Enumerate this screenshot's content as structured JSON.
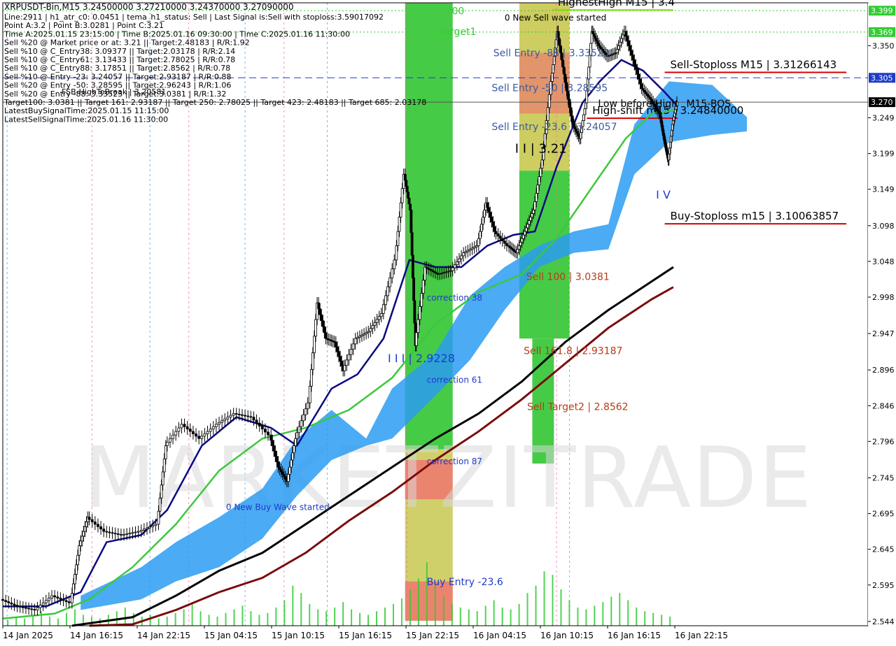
{
  "chart_data": {
    "type": "line",
    "symbol_line": "XRPUSDT-Bin,M15  3.24500000 3.27210000 3.24370000 3.27090000",
    "info_lines": [
      "Line:2911  |  h1_atr_c0: 0.0451  |  tema_h1_status: Sell  |  Last Signal is:Sell with stoploss:3.59017092",
      "Point A:3.2  |  Point B:3.0281  |  Point C:3.21",
      "Time A:2025.01.15 23:15:00  |  Time B:2025.01.16 09:30:00  |  Time C:2025.01.16 11:30:00",
      "Sell %20 @ Market price or at: 3.21  ||  Target:2.48183  |  R/R:1.92",
      "Sell %10 @ C_Entry38: 3.09377  ||  Target:2.03178  |  R/R:2.14",
      "Sell %10 @ C_Entry61: 3.13433  ||  Target:2.78025  |  R/R:0.78",
      "Sell %10 @ C_Entry88: 3.17851  ||  Target:2.8562  |  R/R:0.78",
      "Sell %10 @ Entry -23: 3.24057  ||  Target:2.93187  |  R/R:0.88",
      "Sell %20 @ Entry -50: 3.28595  ||  Target:2.96243  |  R/R:1.06",
      "Sell %20 @ Entry -88: 3.33523  ||  Target:3.0381  |  R/R:1.32",
      "Target100: 3.0381  ||  Target 161: 2.93187  ||  Target 250: 2.78025  ||  Target 423: 2.48183  ||  Target 685: 2.03178",
      "LatestBuySignalTime:2025.01.15 11:15:00",
      "LatestSellSignalTime:2025.01.16 11:30:00"
    ],
    "fsb_label": "FSB-HighToBreak  |  3.20581",
    "x_tick_labels": [
      "14 Jan 2025",
      "14 Jan 16:15",
      "14 Jan 22:15",
      "15 Jan 04:15",
      "15 Jan 10:15",
      "15 Jan 16:15",
      "15 Jan 22:15",
      "16 Jan 04:15",
      "16 Jan 10:15",
      "16 Jan 16:15",
      "16 Jan 22:15"
    ],
    "y_ticks": [
      3.35,
      3.249,
      3.199,
      3.149,
      3.098,
      3.048,
      2.998,
      2.947,
      2.896,
      2.846,
      2.796,
      2.745,
      2.695,
      2.645,
      2.595,
      2.544
    ],
    "y_tick_labels": [
      "3.350",
      "3.249",
      "3.199",
      "3.149",
      "3.098",
      "3.048",
      "2.998",
      "2.947",
      "2.896",
      "2.846",
      "2.796",
      "2.745",
      "2.695",
      "2.645",
      "2.595",
      "2.544"
    ],
    "ylim": [
      2.538,
      3.41
    ],
    "price_tags": [
      {
        "value": 3.399,
        "label": "3.399",
        "color": "#32cd32"
      },
      {
        "value": 3.369,
        "label": "3.369",
        "color": "#32cd32"
      },
      {
        "value": 3.305,
        "label": "3.305",
        "color": "#1e3cc8"
      },
      {
        "value": 3.2709,
        "label": "3.270",
        "color": "#000000"
      }
    ],
    "h_lines": [
      {
        "value": 3.399,
        "color": "#32cd32",
        "dash": "2,3"
      },
      {
        "value": 3.369,
        "color": "#32cd32",
        "dash": "2,3"
      },
      {
        "value": 3.305,
        "color": "#1e3cc8",
        "dash": "10,6"
      },
      {
        "value": 3.2709,
        "color": "#555555",
        "dash": ""
      }
    ],
    "levels": [
      {
        "label": "HighestHigh   M15 | 3.4",
        "value": 3.4,
        "color": "#000000",
        "line_color": "#7fe000",
        "from": 0.635,
        "to": 0.775
      },
      {
        "label": "Sell-Stoploss M15 | 3.31266143",
        "value": 3.31266143,
        "color": "#000000",
        "line_color": "#d40000",
        "from": 0.765,
        "to": 0.975
      },
      {
        "label": "High-shift m15 | 3.24840000",
        "value": 3.2484,
        "color": "#000000",
        "line_color": "#d40000",
        "from": 0.675,
        "to": 0.78
      },
      {
        "label": "Buy-Stoploss m15 | 3.10063857",
        "value": 3.10063857,
        "color": "#000000",
        "line_color": "#d40000",
        "from": 0.765,
        "to": 0.975
      }
    ],
    "annotations": [
      {
        "text": "0 New Sell wave started",
        "x": 0.58,
        "y": 3.385,
        "color": "#000000",
        "size": 12
      },
      {
        "text": "Sell Entry -88 | 3.33523",
        "x": 0.567,
        "y": 3.335,
        "color": "#3c5aa0",
        "size": 14
      },
      {
        "text": "Sell Entry -50 | 3.28595",
        "x": 0.565,
        "y": 3.286,
        "color": "#3c5aa0",
        "size": 14
      },
      {
        "text": "Sell Entry -23.6 | 3.24057",
        "x": 0.565,
        "y": 3.232,
        "color": "#3c5aa0",
        "size": 14
      },
      {
        "text": "Low before High",
        "x": 0.688,
        "y": 3.264,
        "color": "#000000",
        "size": 14
      },
      {
        "text": "M15-BOS",
        "x": 0.79,
        "y": 3.264,
        "color": "#000000",
        "size": 14
      },
      {
        "text": "I I | 3.21",
        "x": 0.592,
        "y": 3.2,
        "color": "#000000",
        "size": 18
      },
      {
        "text": "I V",
        "x": 0.755,
        "y": 3.136,
        "color": "#1e3cc8",
        "size": 16
      },
      {
        "text": "Sell 100 | 3.0381",
        "x": 0.605,
        "y": 3.022,
        "color": "#b43c14",
        "size": 14
      },
      {
        "text": "Sell 161.8 | 2.93187",
        "x": 0.602,
        "y": 2.918,
        "color": "#b43c14",
        "size": 14
      },
      {
        "text": "Sell Target2 | 2.8562",
        "x": 0.606,
        "y": 2.84,
        "color": "#b43c14",
        "size": 14
      },
      {
        "text": "I I I | 2.9228",
        "x": 0.445,
        "y": 2.907,
        "color": "#1e3cc8",
        "size": 16
      },
      {
        "text": "correction 38",
        "x": 0.49,
        "y": 2.993,
        "color": "#1e3cc8",
        "size": 12
      },
      {
        "text": "correction 61",
        "x": 0.49,
        "y": 2.878,
        "color": "#1e3cc8",
        "size": 12
      },
      {
        "text": "correction 87",
        "x": 0.49,
        "y": 2.764,
        "color": "#1e3cc8",
        "size": 12
      },
      {
        "text": "Buy Entry -23.6",
        "x": 0.49,
        "y": 2.595,
        "color": "#1e3cc8",
        "size": 14
      },
      {
        "text": "0 New Buy Wave started",
        "x": 0.258,
        "y": 2.7,
        "color": "#1e3cc8",
        "size": 12
      },
      {
        "text": "Target1",
        "x": 0.505,
        "y": 3.365,
        "color": "#32cd32",
        "size": 14
      },
      {
        "text": "00",
        "x": 0.519,
        "y": 3.394,
        "color": "#32cd32",
        "size": 14
      }
    ],
    "zones": [
      {
        "x0": 0.465,
        "x1": 0.52,
        "y0": 3.41,
        "y1": 2.785,
        "color": "#3cc83c",
        "opacity": 0.95
      },
      {
        "x0": 0.465,
        "x1": 0.52,
        "y0": 2.785,
        "y1": 2.545,
        "color": "#c8c850",
        "opacity": 0.85
      },
      {
        "x0": 0.465,
        "x1": 0.52,
        "y0": 2.77,
        "y1": 2.715,
        "color": "#f07070",
        "opacity": 0.8
      },
      {
        "x0": 0.465,
        "x1": 0.52,
        "y0": 2.6,
        "y1": 2.545,
        "color": "#f07070",
        "opacity": 0.8
      },
      {
        "x0": 0.597,
        "x1": 0.655,
        "y0": 3.41,
        "y1": 3.175,
        "color": "#c8c850",
        "opacity": 0.9
      },
      {
        "x0": 0.597,
        "x1": 0.655,
        "y0": 3.34,
        "y1": 3.255,
        "color": "#f07070",
        "opacity": 0.6
      },
      {
        "x0": 0.597,
        "x1": 0.655,
        "y0": 3.175,
        "y1": 2.94,
        "color": "#3cc83c",
        "opacity": 0.95
      },
      {
        "x0": 0.612,
        "x1": 0.637,
        "y0": 2.94,
        "y1": 2.765,
        "color": "#3cc83c",
        "opacity": 0.95
      }
    ],
    "watermark": "MARKETZITRADE",
    "price_series": [
      {
        "t": 0.0,
        "v": 2.575
      },
      {
        "t": 0.02,
        "v": 2.565
      },
      {
        "t": 0.04,
        "v": 2.56
      },
      {
        "t": 0.06,
        "v": 2.58
      },
      {
        "t": 0.08,
        "v": 2.57
      },
      {
        "t": 0.09,
        "v": 2.65
      },
      {
        "t": 0.1,
        "v": 2.69
      },
      {
        "t": 0.12,
        "v": 2.67
      },
      {
        "t": 0.14,
        "v": 2.665
      },
      {
        "t": 0.16,
        "v": 2.67
      },
      {
        "t": 0.18,
        "v": 2.68
      },
      {
        "t": 0.19,
        "v": 2.79
      },
      {
        "t": 0.21,
        "v": 2.82
      },
      {
        "t": 0.23,
        "v": 2.8
      },
      {
        "t": 0.25,
        "v": 2.82
      },
      {
        "t": 0.27,
        "v": 2.835
      },
      {
        "t": 0.29,
        "v": 2.83
      },
      {
        "t": 0.31,
        "v": 2.805
      },
      {
        "t": 0.32,
        "v": 2.76
      },
      {
        "t": 0.33,
        "v": 2.74
      },
      {
        "t": 0.34,
        "v": 2.8
      },
      {
        "t": 0.355,
        "v": 2.85
      },
      {
        "t": 0.365,
        "v": 2.99
      },
      {
        "t": 0.375,
        "v": 2.94
      },
      {
        "t": 0.385,
        "v": 2.935
      },
      {
        "t": 0.395,
        "v": 2.895
      },
      {
        "t": 0.41,
        "v": 2.94
      },
      {
        "t": 0.425,
        "v": 2.95
      },
      {
        "t": 0.44,
        "v": 2.975
      },
      {
        "t": 0.455,
        "v": 3.05
      },
      {
        "t": 0.465,
        "v": 3.17
      },
      {
        "t": 0.472,
        "v": 3.12
      },
      {
        "t": 0.478,
        "v": 2.93
      },
      {
        "t": 0.49,
        "v": 3.04
      },
      {
        "t": 0.505,
        "v": 3.03
      },
      {
        "t": 0.52,
        "v": 3.035
      },
      {
        "t": 0.535,
        "v": 3.06
      },
      {
        "t": 0.55,
        "v": 3.07
      },
      {
        "t": 0.56,
        "v": 3.13
      },
      {
        "t": 0.57,
        "v": 3.09
      },
      {
        "t": 0.585,
        "v": 3.07
      },
      {
        "t": 0.595,
        "v": 3.06
      },
      {
        "t": 0.605,
        "v": 3.09
      },
      {
        "t": 0.615,
        "v": 3.12
      },
      {
        "t": 0.625,
        "v": 3.19
      },
      {
        "t": 0.635,
        "v": 3.3
      },
      {
        "t": 0.642,
        "v": 3.37
      },
      {
        "t": 0.65,
        "v": 3.31
      },
      {
        "t": 0.66,
        "v": 3.24
      },
      {
        "t": 0.668,
        "v": 3.22
      },
      {
        "t": 0.675,
        "v": 3.27
      },
      {
        "t": 0.682,
        "v": 3.37
      },
      {
        "t": 0.69,
        "v": 3.35
      },
      {
        "t": 0.7,
        "v": 3.335
      },
      {
        "t": 0.71,
        "v": 3.34
      },
      {
        "t": 0.72,
        "v": 3.37
      },
      {
        "t": 0.73,
        "v": 3.33
      },
      {
        "t": 0.74,
        "v": 3.29
      },
      {
        "t": 0.75,
        "v": 3.275
      },
      {
        "t": 0.76,
        "v": 3.255
      },
      {
        "t": 0.765,
        "v": 3.22
      },
      {
        "t": 0.77,
        "v": 3.19
      },
      {
        "t": 0.775,
        "v": 3.24
      },
      {
        "t": 0.78,
        "v": 3.271
      }
    ],
    "ma_fast": [
      {
        "t": 0.0,
        "v": 2.565
      },
      {
        "t": 0.05,
        "v": 2.565
      },
      {
        "t": 0.09,
        "v": 2.585
      },
      {
        "t": 0.12,
        "v": 2.655
      },
      {
        "t": 0.16,
        "v": 2.665
      },
      {
        "t": 0.19,
        "v": 2.7
      },
      {
        "t": 0.23,
        "v": 2.79
      },
      {
        "t": 0.27,
        "v": 2.83
      },
      {
        "t": 0.31,
        "v": 2.815
      },
      {
        "t": 0.34,
        "v": 2.79
      },
      {
        "t": 0.38,
        "v": 2.87
      },
      {
        "t": 0.41,
        "v": 2.89
      },
      {
        "t": 0.44,
        "v": 2.94
      },
      {
        "t": 0.47,
        "v": 3.05
      },
      {
        "t": 0.5,
        "v": 3.04
      },
      {
        "t": 0.53,
        "v": 3.04
      },
      {
        "t": 0.56,
        "v": 3.07
      },
      {
        "t": 0.59,
        "v": 3.085
      },
      {
        "t": 0.615,
        "v": 3.09
      },
      {
        "t": 0.64,
        "v": 3.18
      },
      {
        "t": 0.67,
        "v": 3.27
      },
      {
        "t": 0.69,
        "v": 3.3
      },
      {
        "t": 0.715,
        "v": 3.33
      },
      {
        "t": 0.74,
        "v": 3.315
      },
      {
        "t": 0.765,
        "v": 3.285
      },
      {
        "t": 0.78,
        "v": 3.265
      }
    ],
    "ma_mid": [
      {
        "t": 0.0,
        "v": 2.548
      },
      {
        "t": 0.06,
        "v": 2.555
      },
      {
        "t": 0.1,
        "v": 2.575
      },
      {
        "t": 0.15,
        "v": 2.62
      },
      {
        "t": 0.2,
        "v": 2.68
      },
      {
        "t": 0.25,
        "v": 2.755
      },
      {
        "t": 0.3,
        "v": 2.8
      },
      {
        "t": 0.35,
        "v": 2.815
      },
      {
        "t": 0.4,
        "v": 2.84
      },
      {
        "t": 0.45,
        "v": 2.885
      },
      {
        "t": 0.5,
        "v": 2.96
      },
      {
        "t": 0.55,
        "v": 3.005
      },
      {
        "t": 0.6,
        "v": 3.03
      },
      {
        "t": 0.64,
        "v": 3.08
      },
      {
        "t": 0.68,
        "v": 3.15
      },
      {
        "t": 0.72,
        "v": 3.22
      },
      {
        "t": 0.75,
        "v": 3.255
      },
      {
        "t": 0.78,
        "v": 3.26
      }
    ],
    "ma_slow": [
      {
        "t": 0.08,
        "v": 2.538
      },
      {
        "t": 0.15,
        "v": 2.55
      },
      {
        "t": 0.2,
        "v": 2.58
      },
      {
        "t": 0.25,
        "v": 2.615
      },
      {
        "t": 0.3,
        "v": 2.64
      },
      {
        "t": 0.35,
        "v": 2.68
      },
      {
        "t": 0.4,
        "v": 2.72
      },
      {
        "t": 0.45,
        "v": 2.76
      },
      {
        "t": 0.5,
        "v": 2.8
      },
      {
        "t": 0.55,
        "v": 2.835
      },
      {
        "t": 0.6,
        "v": 2.88
      },
      {
        "t": 0.65,
        "v": 2.935
      },
      {
        "t": 0.7,
        "v": 2.98
      },
      {
        "t": 0.75,
        "v": 3.02
      },
      {
        "t": 0.775,
        "v": 3.04
      }
    ],
    "ma_slowest": [
      {
        "t": 0.1,
        "v": 2.538
      },
      {
        "t": 0.15,
        "v": 2.54
      },
      {
        "t": 0.2,
        "v": 2.56
      },
      {
        "t": 0.25,
        "v": 2.585
      },
      {
        "t": 0.3,
        "v": 2.605
      },
      {
        "t": 0.35,
        "v": 2.64
      },
      {
        "t": 0.4,
        "v": 2.685
      },
      {
        "t": 0.45,
        "v": 2.725
      },
      {
        "t": 0.5,
        "v": 2.77
      },
      {
        "t": 0.55,
        "v": 2.81
      },
      {
        "t": 0.6,
        "v": 2.855
      },
      {
        "t": 0.65,
        "v": 2.905
      },
      {
        "t": 0.7,
        "v": 2.955
      },
      {
        "t": 0.75,
        "v": 2.995
      },
      {
        "t": 0.775,
        "v": 3.012
      }
    ],
    "cloud": [
      {
        "t": 0.09,
        "top": 2.58,
        "bot": 2.56
      },
      {
        "t": 0.16,
        "top": 2.62,
        "bot": 2.575
      },
      {
        "t": 0.2,
        "top": 2.655,
        "bot": 2.6
      },
      {
        "t": 0.25,
        "top": 2.69,
        "bot": 2.62
      },
      {
        "t": 0.3,
        "top": 2.73,
        "bot": 2.66
      },
      {
        "t": 0.34,
        "top": 2.8,
        "bot": 2.72
      },
      {
        "t": 0.38,
        "top": 2.84,
        "bot": 2.77
      },
      {
        "t": 0.42,
        "top": 2.8,
        "bot": 2.79
      },
      {
        "t": 0.45,
        "top": 2.87,
        "bot": 2.8
      },
      {
        "t": 0.5,
        "top": 2.92,
        "bot": 2.86
      },
      {
        "t": 0.54,
        "top": 3.0,
        "bot": 2.91
      },
      {
        "t": 0.58,
        "top": 3.04,
        "bot": 2.98
      },
      {
        "t": 0.62,
        "top": 3.07,
        "bot": 3.04
      },
      {
        "t": 0.66,
        "top": 3.09,
        "bot": 3.06
      },
      {
        "t": 0.7,
        "top": 3.1,
        "bot": 3.065
      },
      {
        "t": 0.73,
        "top": 3.24,
        "bot": 3.17
      },
      {
        "t": 0.77,
        "top": 3.3,
        "bot": 3.215
      },
      {
        "t": 0.82,
        "top": 3.295,
        "bot": 3.225
      },
      {
        "t": 0.86,
        "top": 3.25,
        "bot": 3.23
      }
    ],
    "volume": [
      3,
      5,
      4,
      6,
      8,
      5,
      4,
      7,
      9,
      6,
      5,
      4,
      6,
      8,
      10,
      7,
      5,
      6,
      4,
      5,
      7,
      9,
      12,
      8,
      6,
      5,
      7,
      9,
      11,
      8,
      6,
      7,
      10,
      14,
      22,
      18,
      12,
      9,
      8,
      10,
      13,
      9,
      7,
      6,
      8,
      10,
      12,
      15,
      20,
      26,
      35,
      24,
      16,
      12,
      10,
      9,
      8,
      11,
      14,
      10,
      9,
      12,
      18,
      22,
      30,
      28,
      20,
      14,
      10,
      9,
      11,
      13,
      16,
      18,
      14,
      10,
      8,
      7,
      6,
      5
    ],
    "x_labels_min": "",
    "grid": true,
    "legend": ""
  }
}
